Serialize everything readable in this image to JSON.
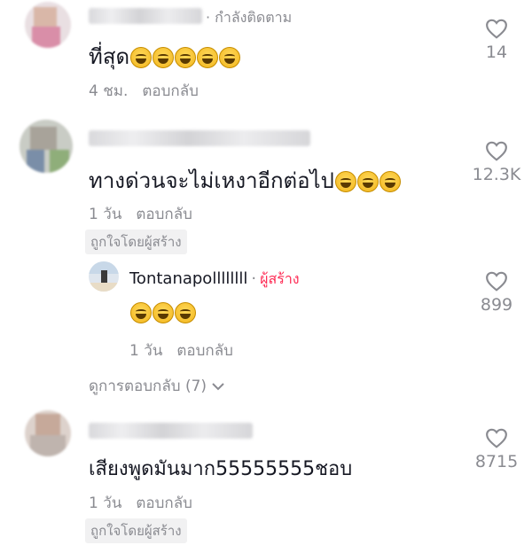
{
  "comments": [
    {
      "following_tag": "· กำลังติดตาม",
      "text": "ที่สุด",
      "emoji_count": 5,
      "time": "4 ชม.",
      "reply_label": "ตอบกลับ",
      "likes": "14"
    },
    {
      "text": "ทางด่วนจะไม่เหงาอีกต่อไป",
      "emoji_count": 3,
      "time": "1 วัน",
      "reply_label": "ตอบกลับ",
      "liked_by_creator": "ถูกใจโดยผู้สร้าง",
      "likes": "12.3K",
      "reply": {
        "username": "Tontanapollllllll",
        "creator_label": "ผู้สร้าง",
        "emoji_count": 3,
        "time": "1 วัน",
        "reply_label": "ตอบกลับ",
        "likes": "899"
      },
      "view_replies": "ดูการตอบกลับ (7)"
    },
    {
      "text": "เสียงพูดมันมาก55555555ชอบ",
      "time": "1 วัน",
      "reply_label": "ตอบกลับ",
      "liked_by_creator": "ถูกใจโดยผู้สร้าง",
      "likes": "8715"
    }
  ],
  "icons": {
    "like": "heart-outline-icon",
    "expand": "chevron-down-icon",
    "emoji": "grinning-emoji-icon"
  },
  "colors": {
    "creator": "#fe2c55",
    "muted": "#8a8b91"
  }
}
